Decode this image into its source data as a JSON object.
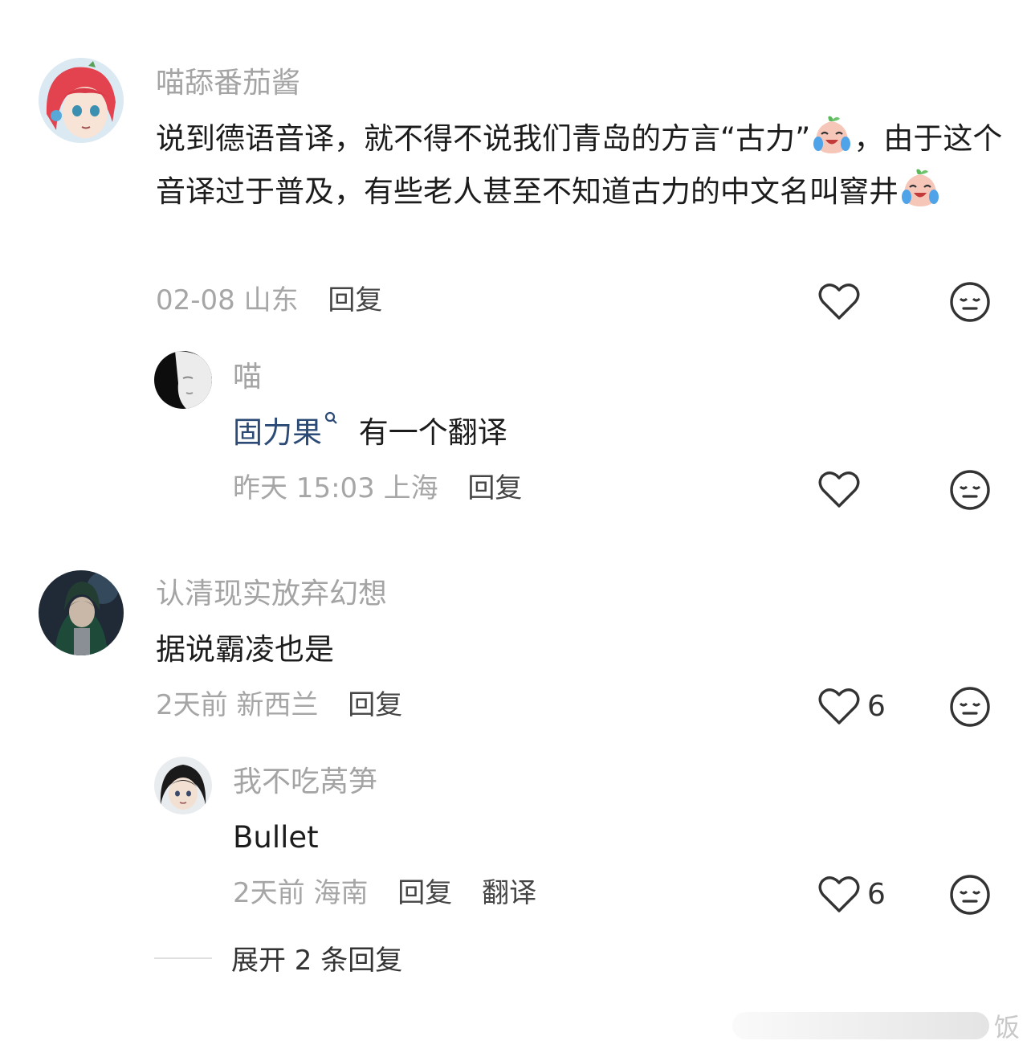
{
  "comments": [
    {
      "username": "喵舔番茄酱",
      "text_before": "说到德语音译，就不得不说我们青岛的方言“古力”",
      "text_middle": "，由于这个音译过于普及，有些老人甚至不知道古力的中文名叫窨井",
      "emoji": "crying-laughing-peach-emoji",
      "time": "02-08",
      "location": "山东",
      "reply_label": "回复",
      "likes": ""
    },
    {
      "username": "喵",
      "link_text": "固力果",
      "text_after": "有一个翻译",
      "time": "昨天 15:03",
      "location": "上海",
      "reply_label": "回复",
      "likes": ""
    },
    {
      "username": "认清现实放弃幻想",
      "text": "据说霸凌也是",
      "time": "2天前",
      "location": "新西兰",
      "reply_label": "回复",
      "likes": "6"
    },
    {
      "username": "我不吃莴笋",
      "text": "Bullet",
      "time": "2天前",
      "location": "海南",
      "reply_label": "回复",
      "translate_label": "翻译",
      "likes": "6"
    }
  ],
  "expand_replies": "展开 2 条回复",
  "watermark": "饭",
  "icons": {
    "like": "heart-outline-icon",
    "dislike": "neutral-face-icon",
    "search": "search-icon"
  },
  "colors": {
    "username": "#a4a4a4",
    "link": "#2c4a76",
    "meta": "#a6a6a6",
    "action": "#454545"
  }
}
